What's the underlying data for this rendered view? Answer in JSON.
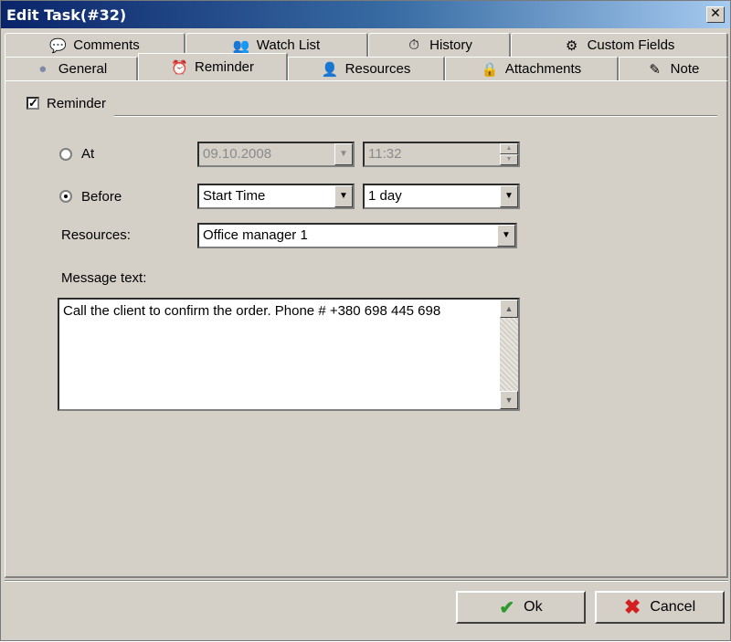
{
  "window": {
    "title": "Edit Task(#32)",
    "close_glyph": "✕"
  },
  "tabs": {
    "row_back": [
      {
        "id": "comments",
        "label": "Comments",
        "icon": "comments-icon",
        "glyph": "💬"
      },
      {
        "id": "watch-list",
        "label": "Watch List",
        "icon": "watch-list-icon",
        "glyph": "👥"
      },
      {
        "id": "history",
        "label": "History",
        "icon": "history-icon",
        "glyph": "⏱"
      },
      {
        "id": "custom-fields",
        "label": "Custom Fields",
        "icon": "custom-fields-icon",
        "glyph": "⚙"
      }
    ],
    "row_front": [
      {
        "id": "general",
        "label": "General",
        "icon": "general-icon",
        "glyph": "●"
      },
      {
        "id": "reminder",
        "label": "Reminder",
        "icon": "alarm-clock-icon",
        "glyph": "⏰",
        "active": true
      },
      {
        "id": "resources",
        "label": "Resources",
        "icon": "person-icon",
        "glyph": "👤"
      },
      {
        "id": "attachments",
        "label": "Attachments",
        "icon": "padlock-icon",
        "glyph": "🔒"
      },
      {
        "id": "note",
        "label": "Note",
        "icon": "note-icon",
        "glyph": "✎"
      }
    ]
  },
  "reminder": {
    "enabled_label": "Reminder",
    "enabled": true,
    "check_glyph": "✓",
    "at_label": "At",
    "at_date": "09.10.2008",
    "at_time": "11:32",
    "before_label": "Before",
    "before_base": "Start Time",
    "before_offset": "1 day",
    "selected_mode": "before",
    "resources_label": "Resources:",
    "resources_value": "Office manager 1",
    "message_label": "Message text:",
    "message_text": "Call the client to confirm the order.  Phone # +380 698 445 698"
  },
  "glyphs": {
    "dropdown": "▼",
    "spin_up": "▲",
    "spin_down": "▼",
    "scroll_up": "▲",
    "scroll_down": "▼"
  },
  "buttons": {
    "ok_label": "Ok",
    "ok_glyph": "✔",
    "cancel_label": "Cancel",
    "cancel_glyph": "✖"
  },
  "colors": {
    "title_start": "#0a246a",
    "title_end": "#a6caf0",
    "face": "#d4d0c8",
    "ok_icon": "#2d9a2d",
    "cancel_icon": "#d21f1f"
  }
}
